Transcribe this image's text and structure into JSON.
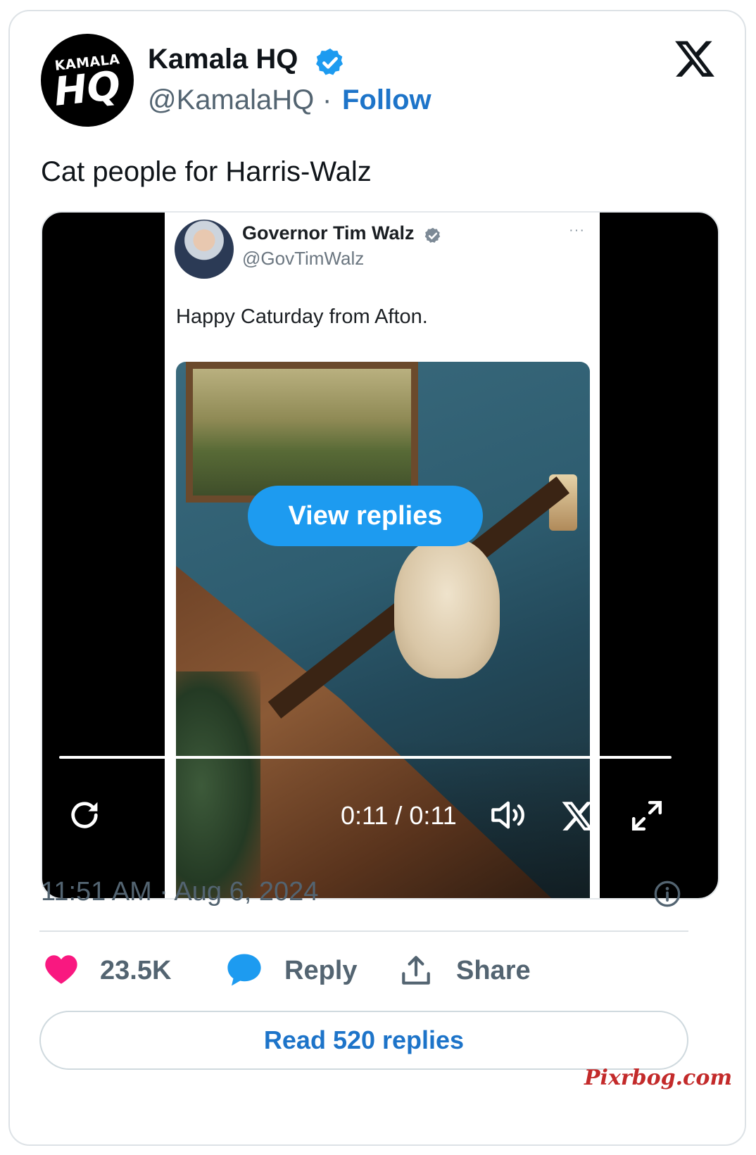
{
  "author": {
    "name": "Kamala HQ",
    "handle": "@KamalaHQ",
    "separator": "·",
    "follow_label": "Follow",
    "avatar_text_top": "KAMALA",
    "avatar_text_main": "HQ"
  },
  "tweet": {
    "text": "Cat people for Harris-Walz"
  },
  "embedded": {
    "name": "Governor Tim Walz",
    "handle": "@GovTimWalz",
    "more": "···",
    "text": "Happy Caturday from Afton."
  },
  "video": {
    "view_replies_label": "View replies",
    "time": "0:11 / 0:11",
    "progress": 1.0
  },
  "meta": {
    "timestamp": "11:51 AM · Aug 6, 2024"
  },
  "actions": {
    "likes": "23.5K",
    "reply_label": "Reply",
    "share_label": "Share"
  },
  "read_replies_label": "Read 520 replies",
  "watermark": "Pixrbog.com",
  "colors": {
    "accent": "#1d9bf0",
    "link": "#1d74c9",
    "heart": "#f91880",
    "muted": "#536471"
  }
}
